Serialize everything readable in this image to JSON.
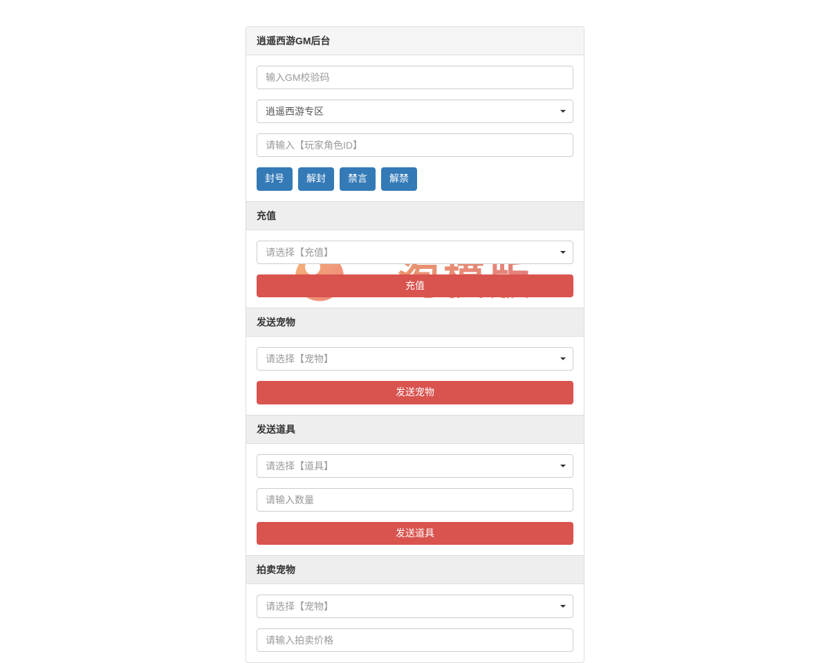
{
  "header": {
    "title": "逍遥西游GM后台"
  },
  "gm": {
    "code_placeholder": "输入GM校验码",
    "zone_selected": "逍遥西游专区",
    "player_placeholder": "请输入【玩家角色ID】"
  },
  "actions": {
    "ban": "封号",
    "unban": "解封",
    "mute": "禁言",
    "unmute": "解禁"
  },
  "recharge": {
    "section": "充值",
    "select_placeholder": "请选择【充值】",
    "submit": "充值"
  },
  "send_pet": {
    "section": "发送宠物",
    "select_placeholder": "请选择【宠物】",
    "submit": "发送宠物"
  },
  "send_item": {
    "section": "发送道具",
    "select_placeholder": "请选择【道具】",
    "qty_placeholder": "请输入数量",
    "submit": "发送道具"
  },
  "auction_pet": {
    "section": "拍卖宠物",
    "select_placeholder": "请选择【宠物】",
    "price_placeholder": "请输入拍卖价格"
  },
  "watermark": {
    "text": "一淘模版"
  }
}
